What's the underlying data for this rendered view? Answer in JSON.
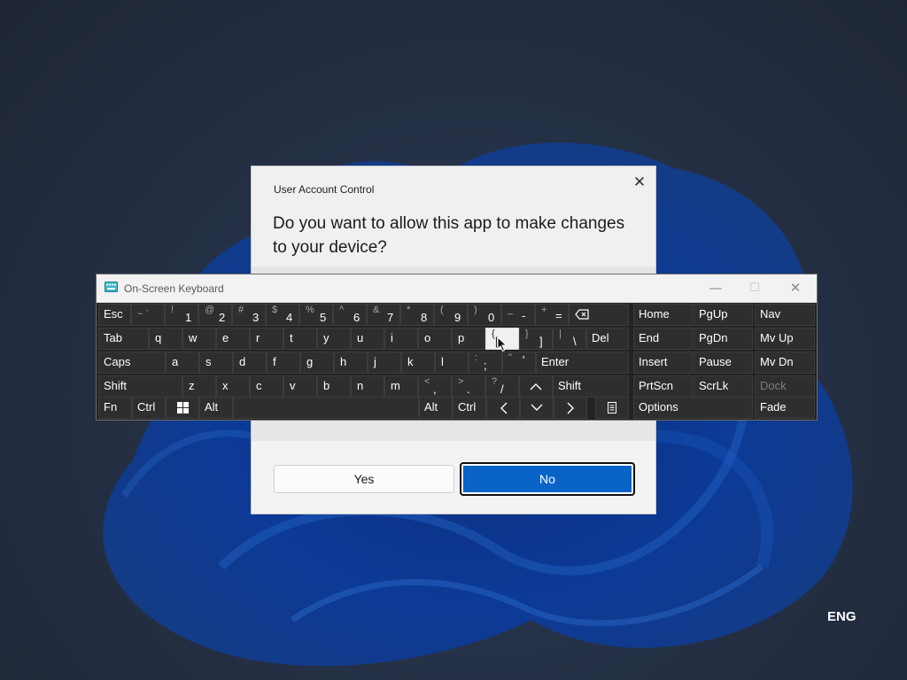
{
  "uac": {
    "title": "User Account Control",
    "question": "Do you want to allow this app to make changes to your device?",
    "yes_label": "Yes",
    "no_label": "No",
    "close_glyph": "✕"
  },
  "osk": {
    "title": "On-Screen Keyboard",
    "minimize_glyph": "—",
    "maximize_glyph": "☐",
    "close_glyph": "✕",
    "row1": {
      "esc": "Esc",
      "tilde": {
        "sec": "~ `",
        "pri": ""
      },
      "k1": {
        "sec": "!",
        "pri": "1"
      },
      "k2": {
        "sec": "@",
        "pri": "2"
      },
      "k3": {
        "sec": "#",
        "pri": "3"
      },
      "k4": {
        "sec": "$",
        "pri": "4"
      },
      "k5": {
        "sec": "%",
        "pri": "5"
      },
      "k6": {
        "sec": "^",
        "pri": "6"
      },
      "k7": {
        "sec": "&",
        "pri": "7"
      },
      "k8": {
        "sec": "*",
        "pri": "8"
      },
      "k9": {
        "sec": "(",
        "pri": "9"
      },
      "k0": {
        "sec": ")",
        "pri": "0"
      },
      "minus": {
        "sec": "_",
        "pri": "-"
      },
      "equals": {
        "sec": "+",
        "pri": "="
      },
      "home": "Home",
      "pgup": "PgUp",
      "nav": "Nav"
    },
    "row2": {
      "tab": "Tab",
      "q": "q",
      "w": "w",
      "e": "e",
      "r": "r",
      "t": "t",
      "y": "y",
      "u": "u",
      "i": "i",
      "o": "o",
      "p": "p",
      "lbracket": {
        "sec": "{",
        "pri": "["
      },
      "rbracket": {
        "sec": "}",
        "pri": "]"
      },
      "backslash": {
        "sec": "|",
        "pri": "\\"
      },
      "del": "Del",
      "end": "End",
      "pgdn": "PgDn",
      "mvup": "Mv Up"
    },
    "row3": {
      "caps": "Caps",
      "a": "a",
      "s": "s",
      "d": "d",
      "f": "f",
      "g": "g",
      "h": "h",
      "j": "j",
      "k": "k",
      "l": "l",
      "semicolon": {
        "sec": ":",
        "pri": ";"
      },
      "quote": {
        "sec": "\"",
        "pri": "'"
      },
      "enter": "Enter",
      "insert": "Insert",
      "pause": "Pause",
      "mvdn": "Mv Dn"
    },
    "row4": {
      "shift_left": "Shift",
      "z": "z",
      "x": "x",
      "c": "c",
      "v": "v",
      "b": "b",
      "n": "n",
      "m": "m",
      "comma": {
        "sec": "<",
        "pri": ","
      },
      "period": {
        "sec": ">",
        "pri": "."
      },
      "slash": {
        "sec": "?",
        "pri": "/"
      },
      "shift_right": "Shift",
      "prtscn": "PrtScn",
      "scrlk": "ScrLk",
      "dock": "Dock"
    },
    "row5": {
      "fn": "Fn",
      "ctrl_left": "Ctrl",
      "alt_left": "Alt",
      "alt_right": "Alt",
      "ctrl_right": "Ctrl",
      "options": "Options",
      "fade": "Fade"
    }
  },
  "taskbar": {
    "language": "ENG"
  }
}
